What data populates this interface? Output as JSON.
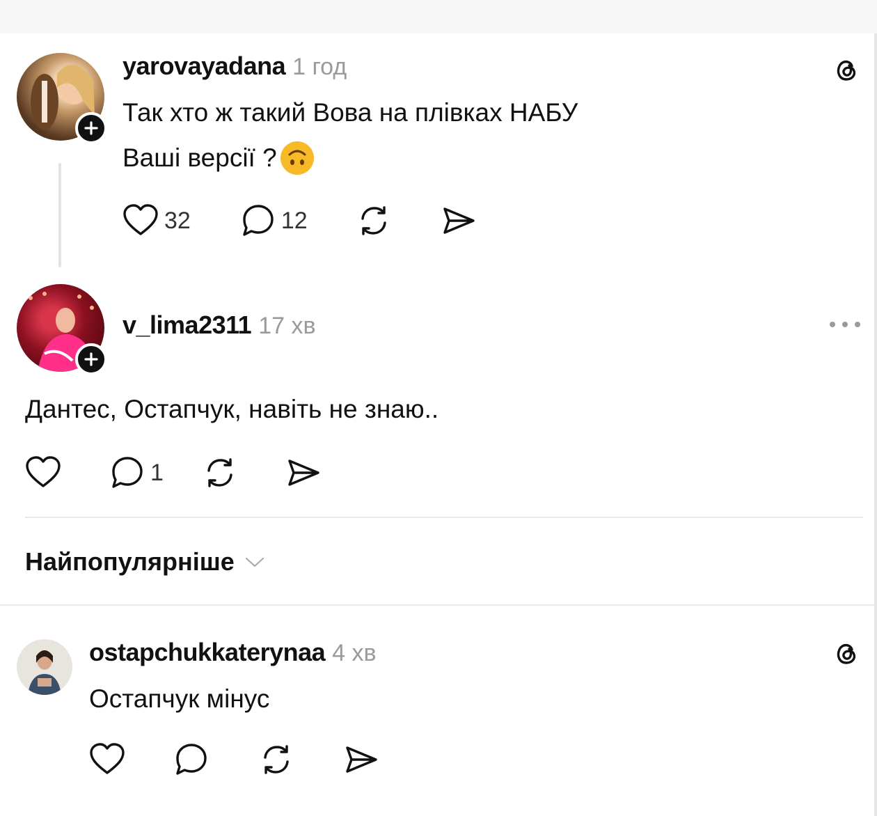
{
  "posts": [
    {
      "username": "yarovayadana",
      "time": "1 год",
      "text_line1": "Так хто ж такий Вова на плівках НАБУ",
      "text_line2": "Ваші версії ?",
      "likes": "32",
      "replies": "12"
    },
    {
      "username": "v_lima2311",
      "time": "17 хв",
      "text": "Дантес, Остапчук, навіть не знаю..",
      "likes": "",
      "replies": "1"
    }
  ],
  "sort_label": "Найпопулярніше",
  "reply": {
    "username": "ostapchukkaterynaa",
    "time": "4 хв",
    "text": "Остапчук мінус",
    "likes": "",
    "replies": ""
  },
  "icons": {
    "threads": "threads-logo-icon",
    "more": "more-dots-icon",
    "like": "heart-icon",
    "reply": "reply-bubble-icon",
    "repost": "repost-icon",
    "share": "share-icon",
    "emoji": "upside-down-face-emoji",
    "chevron": "chevron-down-icon"
  },
  "colors": {
    "text": "#111111",
    "muted": "#9a9a9a",
    "divider": "#e9e9e9",
    "emoji": "#f7b928"
  }
}
